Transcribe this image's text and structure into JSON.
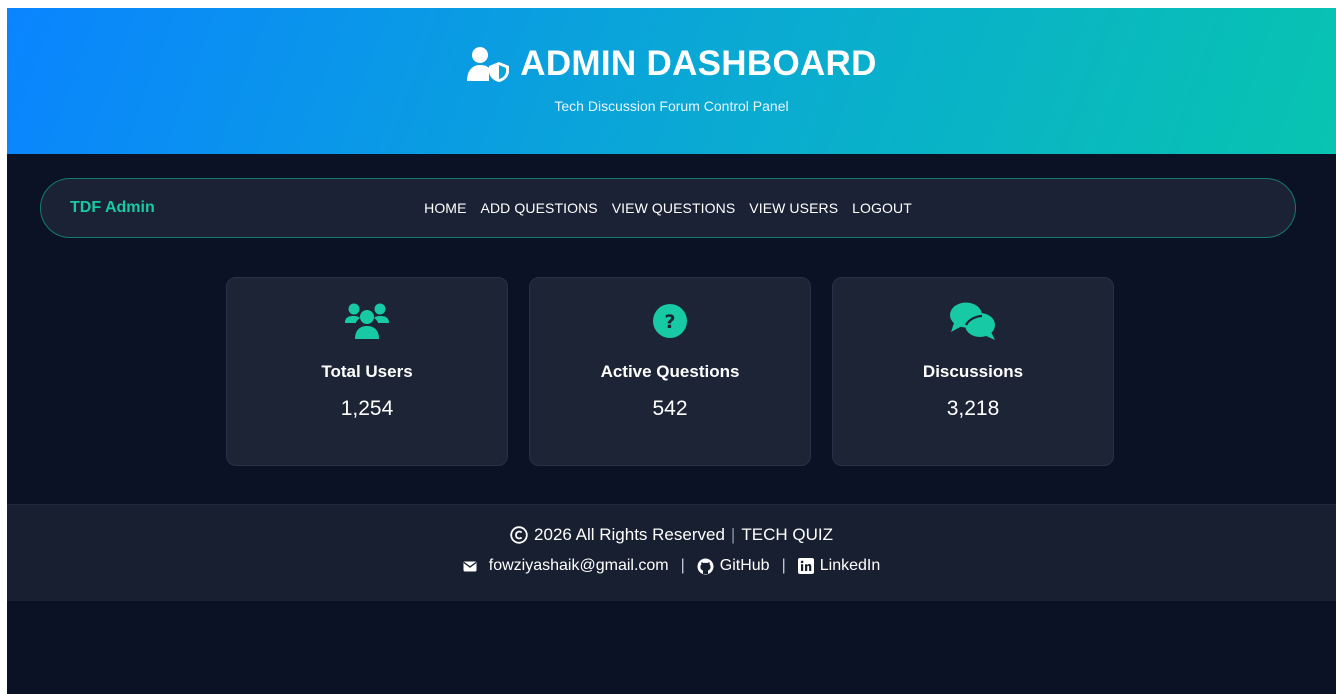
{
  "header": {
    "title": "ADMIN DASHBOARD",
    "subtitle": "Tech Discussion Forum Control Panel",
    "icon": "user-shield-icon"
  },
  "nav": {
    "brand": "TDF Admin",
    "links": [
      {
        "label": "HOME"
      },
      {
        "label": "ADD QUESTIONS"
      },
      {
        "label": "VIEW QUESTIONS"
      },
      {
        "label": "VIEW USERS"
      },
      {
        "label": "LOGOUT"
      }
    ]
  },
  "stats": [
    {
      "icon": "users-icon",
      "label": "Total Users",
      "value": "1,254"
    },
    {
      "icon": "question-circle-icon",
      "label": "Active Questions",
      "value": "542"
    },
    {
      "icon": "comments-icon",
      "label": "Discussions",
      "value": "3,218"
    }
  ],
  "footer": {
    "copyright": "2026 All Rights Reserved",
    "separator": "|",
    "brand": "TECH QUIZ",
    "email": "fowziyashaik@gmail.com",
    "github": "GitHub",
    "linkedin": "LinkedIn",
    "divider": "|"
  },
  "colors": {
    "accent": "#18c9a5",
    "background": "#0c1226",
    "card": "#1d2436",
    "hero_start": "#0a84ff",
    "hero_end": "#08c4b0"
  }
}
